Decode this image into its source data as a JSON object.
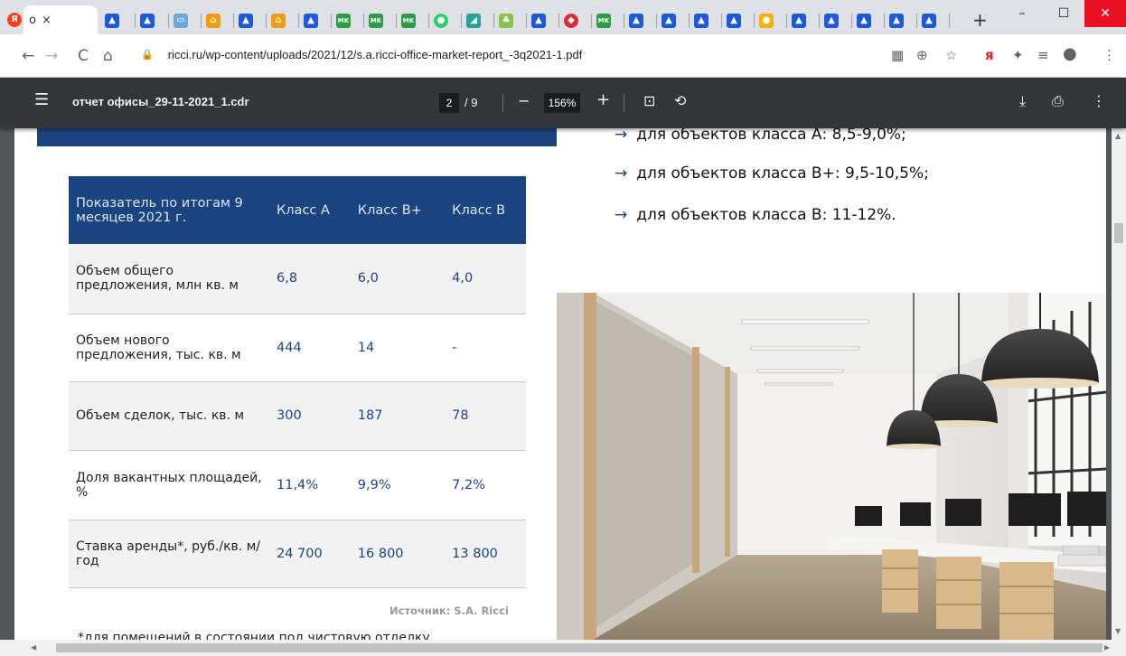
{
  "browser": {
    "active_tab_label": "о",
    "new_tab_label": "+",
    "close_tab_label": "×",
    "url": "ricci.ru/wp-content/uploads/2021/12/s.a.ricci-office-market-report_-3q2021-1.pdf"
  },
  "pdf_toolbar": {
    "document_title": "отчет офисы_29-11-2021_1.cdr",
    "current_page": "2",
    "total_pages": "/ 9",
    "zoom": "156%",
    "zoom_out": "−",
    "zoom_in": "+"
  },
  "bullets": [
    "для объектов класса А: 8,5-9,0%;",
    "для объектов класса В+: 9,5-10,5%;",
    "для объектов класса В: 11-12%."
  ],
  "table": {
    "headers": [
      "Показатель по итогам 9 месяцев 2021 г.",
      "Класс А",
      "Класс В+",
      "Класс В"
    ],
    "rows": [
      {
        "label": "Объем общего предложения, млн кв. м",
        "a": "6,8",
        "bplus": "6,0",
        "b": "4,0"
      },
      {
        "label": "Объем нового предложения, тыс. кв. м",
        "a": "444",
        "bplus": "14",
        "b": "-"
      },
      {
        "label": "Объем сделок, тыс. кв. м",
        "a": "300",
        "bplus": "187",
        "b": "78"
      },
      {
        "label": "Доля вакантных площадей, %",
        "a": "11,4%",
        "bplus": "9,9%",
        "b": "7,2%"
      },
      {
        "label": "Ставка аренды*, руб./кв. м/год",
        "a": "24 700",
        "bplus": "16 800",
        "b": "13 800"
      }
    ],
    "source": "Источник: S.A. Ricci"
  },
  "footnote": "*для помещений в состоянии под чистовую отделку",
  "colors": {
    "brand_blue": "#1a4480",
    "pdf_toolbar": "#323639"
  }
}
